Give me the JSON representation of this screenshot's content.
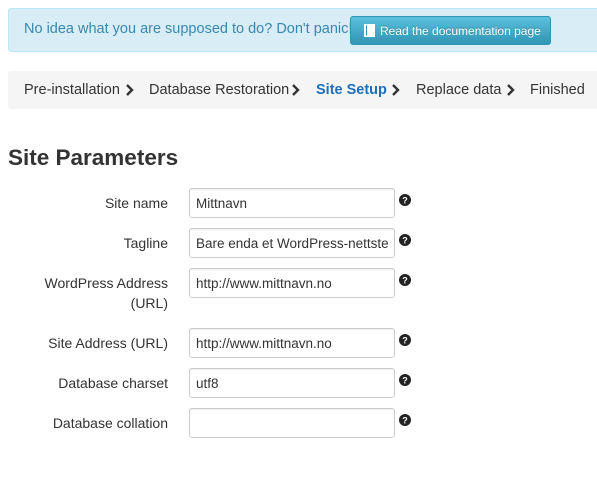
{
  "notice": {
    "text": "No idea what you are supposed to do? Don't panic!",
    "button_label": "Read the documentation page",
    "button_icon": "book-icon"
  },
  "breadcrumb": {
    "steps": [
      {
        "label": "Pre-installation",
        "active": false
      },
      {
        "label": "Database Restoration",
        "active": false
      },
      {
        "label": "Site Setup",
        "active": true
      },
      {
        "label": "Replace data",
        "active": false
      },
      {
        "label": "Finished",
        "active": false
      }
    ],
    "separator_icon": "chevron-right-icon"
  },
  "section_title": "Site Parameters",
  "form": {
    "site_name": {
      "label": "Site name",
      "value": "Mittnavn"
    },
    "tagline": {
      "label": "Tagline",
      "value": "Bare enda et WordPress-nettsted"
    },
    "wp_address": {
      "label_line1": "WordPress Address",
      "label_line2": "(URL)",
      "value": "http://www.mittnavn.no"
    },
    "site_address": {
      "label": "Site Address (URL)",
      "value": "http://www.mittnavn.no"
    },
    "db_charset": {
      "label": "Database charset",
      "value": "utf8"
    },
    "db_collation": {
      "label": "Database collation",
      "value": ""
    },
    "help_icon": "question-circle-icon"
  },
  "colors": {
    "notice_bg": "#d9edf7",
    "notice_text": "#3a87ad",
    "button_bg": "#49afcd",
    "active_step": "#1e6fb8"
  }
}
